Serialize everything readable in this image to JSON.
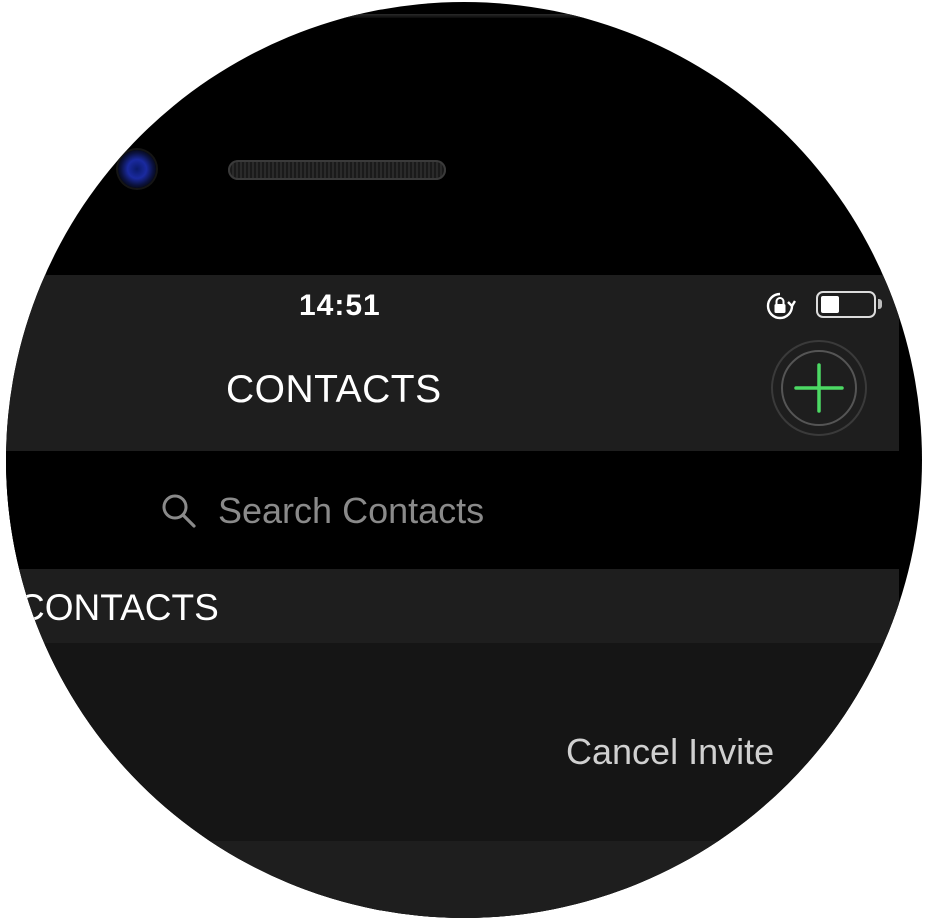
{
  "status_bar": {
    "time": "14:51",
    "battery_level": 0.35,
    "orientation_lock_icon": "rotation-lock-icon"
  },
  "nav": {
    "title": "CONTACTS",
    "add_icon": "plus-icon",
    "accent_color": "#4cd964"
  },
  "search": {
    "placeholder": "Search Contacts",
    "value": "",
    "icon": "search-icon"
  },
  "section": {
    "header": "CONTACTS"
  },
  "contacts": [
    {
      "action_label": "Cancel Invite"
    }
  ]
}
